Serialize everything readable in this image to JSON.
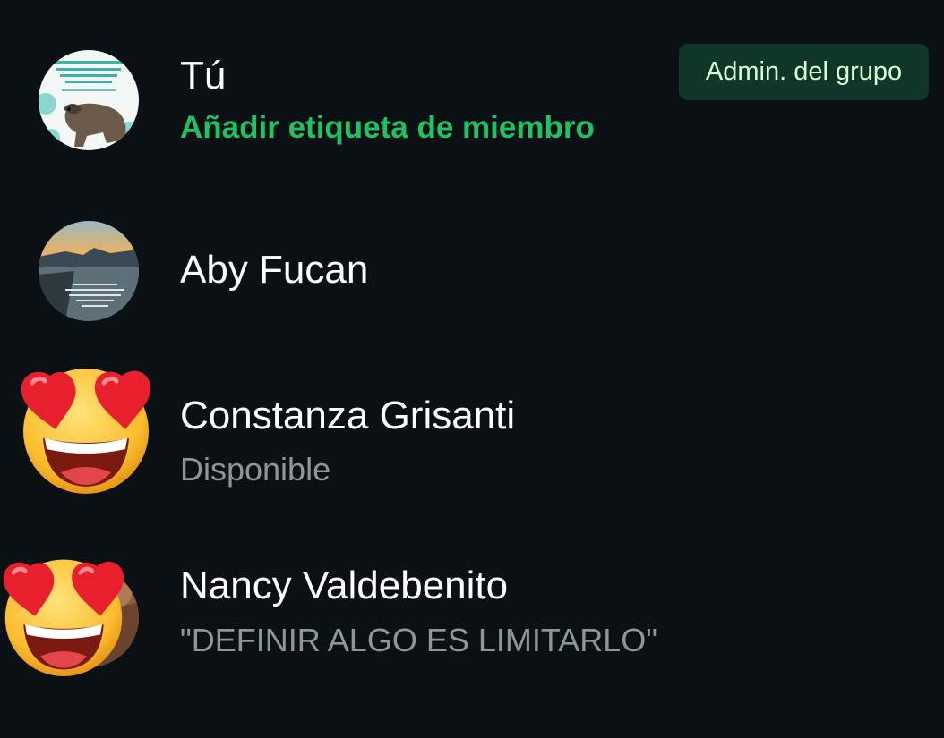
{
  "participants": [
    {
      "name": "Tú",
      "subtitle": "Añadir etiqueta de miembro",
      "badge": "Admin. del grupo",
      "avatar_icon": "photo-avatar"
    },
    {
      "name": "Aby Fucan",
      "avatar_icon": "photo-avatar"
    },
    {
      "name": "Constanza Grisanti",
      "subtitle": "Disponible",
      "avatar_icon": "heart-eyes-emoji"
    },
    {
      "name": "Nancy Valdebenito",
      "subtitle": "\"DEFINIR ALGO ES LIMITARLO\"",
      "avatar_icon": "heart-eyes-emoji"
    }
  ],
  "colors": {
    "background": "#0b1014",
    "accent_green": "#21c063",
    "badge_background": "#103529",
    "badge_text": "#d9fdd3",
    "secondary_text": "#8d969b"
  }
}
